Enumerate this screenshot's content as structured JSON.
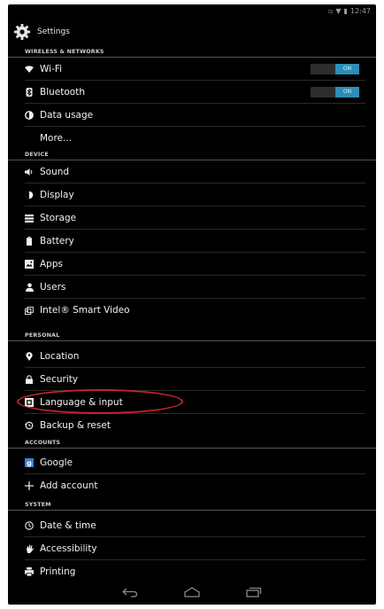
{
  "status_bar": {
    "time": "12:47"
  },
  "header": {
    "title": "Settings"
  },
  "sections": {
    "wireless": "WIRELESS & NETWORKS",
    "device": "DEVICE",
    "personal": "PERSONAL",
    "accounts": "ACCOUNTS",
    "system": "SYSTEM"
  },
  "items": {
    "wifi": "Wi-Fi",
    "bluetooth": "Bluetooth",
    "data_usage": "Data usage",
    "more": "More...",
    "sound": "Sound",
    "display": "Display",
    "storage": "Storage",
    "battery": "Battery",
    "apps": "Apps",
    "users": "Users",
    "intel_video": "Intel® Smart Video",
    "location": "Location",
    "security": "Security",
    "language_input": "Language & input",
    "backup_reset": "Backup & reset",
    "google": "Google",
    "add_account": "Add account",
    "date_time": "Date & time",
    "accessibility": "Accessibility",
    "printing": "Printing"
  },
  "toggles": {
    "wifi": "ON",
    "bluetooth": "ON"
  },
  "colors": {
    "toggle_on": "#2a8fb8",
    "highlight": "#c8232a",
    "background": "#000000"
  }
}
